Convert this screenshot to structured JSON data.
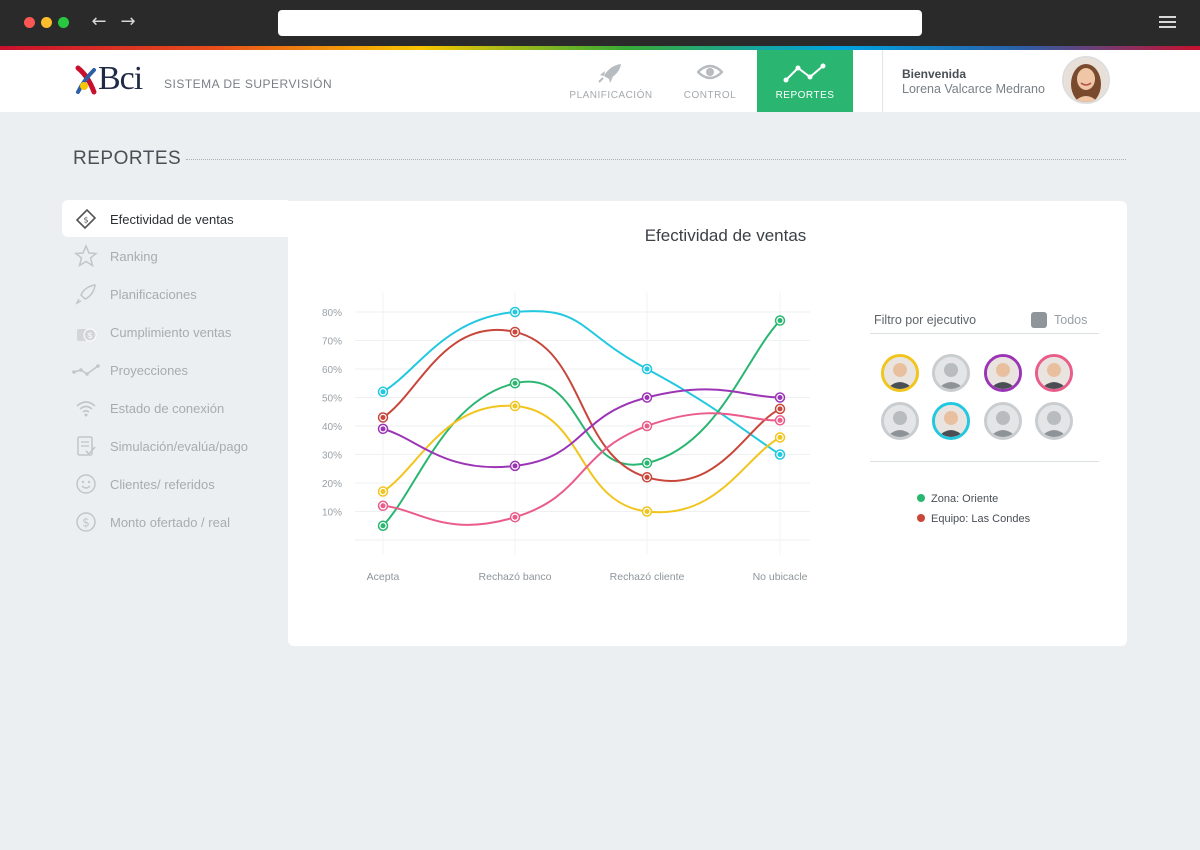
{
  "app": {
    "brand": "Bci",
    "system_title": "SISTEMA DE SUPERVISIÓN"
  },
  "nav": {
    "tabs": [
      {
        "label": "PLANIFICACIÓN",
        "icon": "rocket-icon",
        "active": false
      },
      {
        "label": "CONTROL",
        "icon": "eye-icon",
        "active": false
      },
      {
        "label": "REPORTES",
        "icon": "line-chart-icon",
        "active": true
      }
    ]
  },
  "user": {
    "greeting": "Bienvenida",
    "name": "Lorena Valcarce Medrano"
  },
  "page": {
    "title": "REPORTES"
  },
  "sidebar": {
    "items": [
      {
        "label": "Efectividad de ventas",
        "icon": "money-tag-icon",
        "active": true
      },
      {
        "label": "Ranking",
        "icon": "star-icon",
        "active": false
      },
      {
        "label": "Planificaciones",
        "icon": "rocket-icon",
        "active": false
      },
      {
        "label": "Cumplimiento ventas",
        "icon": "coins-icon",
        "active": false
      },
      {
        "label": "Proyecciones",
        "icon": "trend-line-icon",
        "active": false
      },
      {
        "label": "Estado de conexión",
        "icon": "wifi-icon",
        "active": false
      },
      {
        "label": "Simulación/evalúa/pago",
        "icon": "checklist-icon",
        "active": false
      },
      {
        "label": "Clientes/ referidos",
        "icon": "smiley-icon",
        "active": false
      },
      {
        "label": "Monto ofertado / real",
        "icon": "dollar-circle-icon",
        "active": false
      }
    ]
  },
  "chart_data": {
    "type": "line",
    "title": "Efectividad de ventas",
    "categories": [
      "Acepta",
      "Rechazó banco",
      "Rechazó cliente",
      "No ubicacle"
    ],
    "y_ticks": [
      "10%",
      "20%",
      "30%",
      "40%",
      "50%",
      "60%",
      "70%",
      "80%"
    ],
    "ylim": [
      0,
      85
    ],
    "grid": true,
    "series": [
      {
        "color": "#22c8df",
        "values": [
          52,
          80,
          60,
          30
        ]
      },
      {
        "color": "#2ab671",
        "values": [
          5,
          55,
          27,
          77
        ]
      },
      {
        "color": "#c8463a",
        "values": [
          43,
          73,
          22,
          46
        ]
      },
      {
        "color": "#f1c51e",
        "values": [
          17,
          47,
          10,
          36
        ]
      },
      {
        "color": "#9b35b6",
        "values": [
          39,
          26,
          50,
          50
        ]
      },
      {
        "color": "#ea5c8a",
        "values": [
          12,
          8,
          40,
          42
        ]
      }
    ]
  },
  "filter": {
    "label": "Filtro por ejecutivo",
    "all_label": "Todos",
    "executives": [
      {
        "ring": "#f1c51e"
      },
      {
        "ring": "#c9cdd0"
      },
      {
        "ring": "#9b35b6"
      },
      {
        "ring": "#ea5c8a"
      },
      {
        "ring": "#c9cdd0"
      },
      {
        "ring": "#22c8df"
      },
      {
        "ring": "#c9cdd0"
      },
      {
        "ring": "#c9cdd0"
      }
    ]
  },
  "legend": [
    {
      "label": "Zona: Oriente",
      "color": "#2ab671"
    },
    {
      "label": "Equipo: Las Condes",
      "color": "#c8463a"
    }
  ]
}
